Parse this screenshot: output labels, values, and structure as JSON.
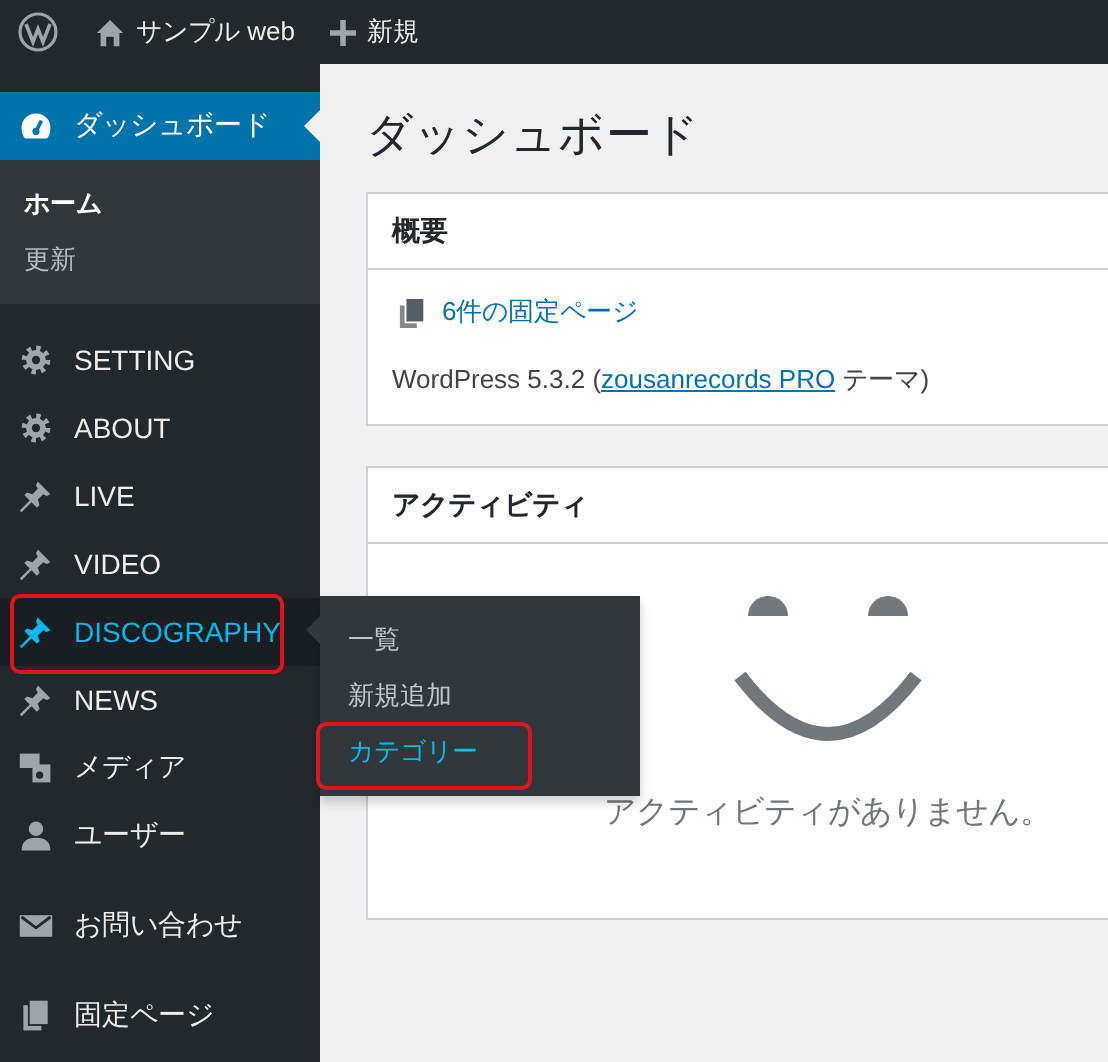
{
  "admin_bar": {
    "site_name": "サンプル web",
    "new_label": "新規"
  },
  "sidebar": {
    "groups": [
      {
        "items": [
          {
            "label": "ダッシュボード",
            "selected": true,
            "hovered": false,
            "highlighted": false,
            "submenu": {
              "kind": "inline",
              "items": [
                {
                  "label": "ホーム",
                  "selected": true,
                  "highlighted": false
                },
                {
                  "label": "更新",
                  "selected": false,
                  "highlighted": false
                }
              ]
            }
          }
        ]
      },
      {
        "items": [
          {
            "label": "SETTING",
            "selected": false,
            "hovered": false,
            "highlighted": false
          },
          {
            "label": "ABOUT",
            "selected": false,
            "hovered": false,
            "highlighted": false
          },
          {
            "label": "LIVE",
            "selected": false,
            "hovered": false,
            "highlighted": false
          },
          {
            "label": "VIDEO",
            "selected": false,
            "hovered": false,
            "highlighted": false
          },
          {
            "label": "DISCOGRAPHY",
            "selected": false,
            "hovered": true,
            "highlighted": true,
            "submenu": {
              "kind": "flyout",
              "items": [
                {
                  "label": "一覧",
                  "selected": false,
                  "highlighted": false
                },
                {
                  "label": "新規追加",
                  "selected": false,
                  "highlighted": false
                },
                {
                  "label": "カテゴリー",
                  "selected": true,
                  "highlighted": true
                }
              ]
            }
          },
          {
            "label": "NEWS",
            "selected": false,
            "hovered": false,
            "highlighted": false
          },
          {
            "label": "メディア",
            "selected": false,
            "hovered": false,
            "highlighted": false
          },
          {
            "label": "ユーザー",
            "selected": false,
            "hovered": false,
            "highlighted": false
          }
        ]
      },
      {
        "items": [
          {
            "label": "お問い合わせ",
            "selected": false,
            "hovered": false,
            "highlighted": false
          }
        ]
      },
      {
        "items": [
          {
            "label": "固定ページ",
            "selected": false,
            "hovered": false,
            "highlighted": false
          }
        ]
      }
    ]
  },
  "page_title": "ダッシュボード",
  "overview": {
    "title": "概要",
    "pages_link": "6件の固定ページ",
    "version_text": {
      "before": "WordPress 5.3.2 (",
      "link": "zousanrecords PRO",
      "after": " テーマ)"
    }
  },
  "activity": {
    "title": "アクティビティ",
    "empty_text": "アクティビティがありません。"
  }
}
